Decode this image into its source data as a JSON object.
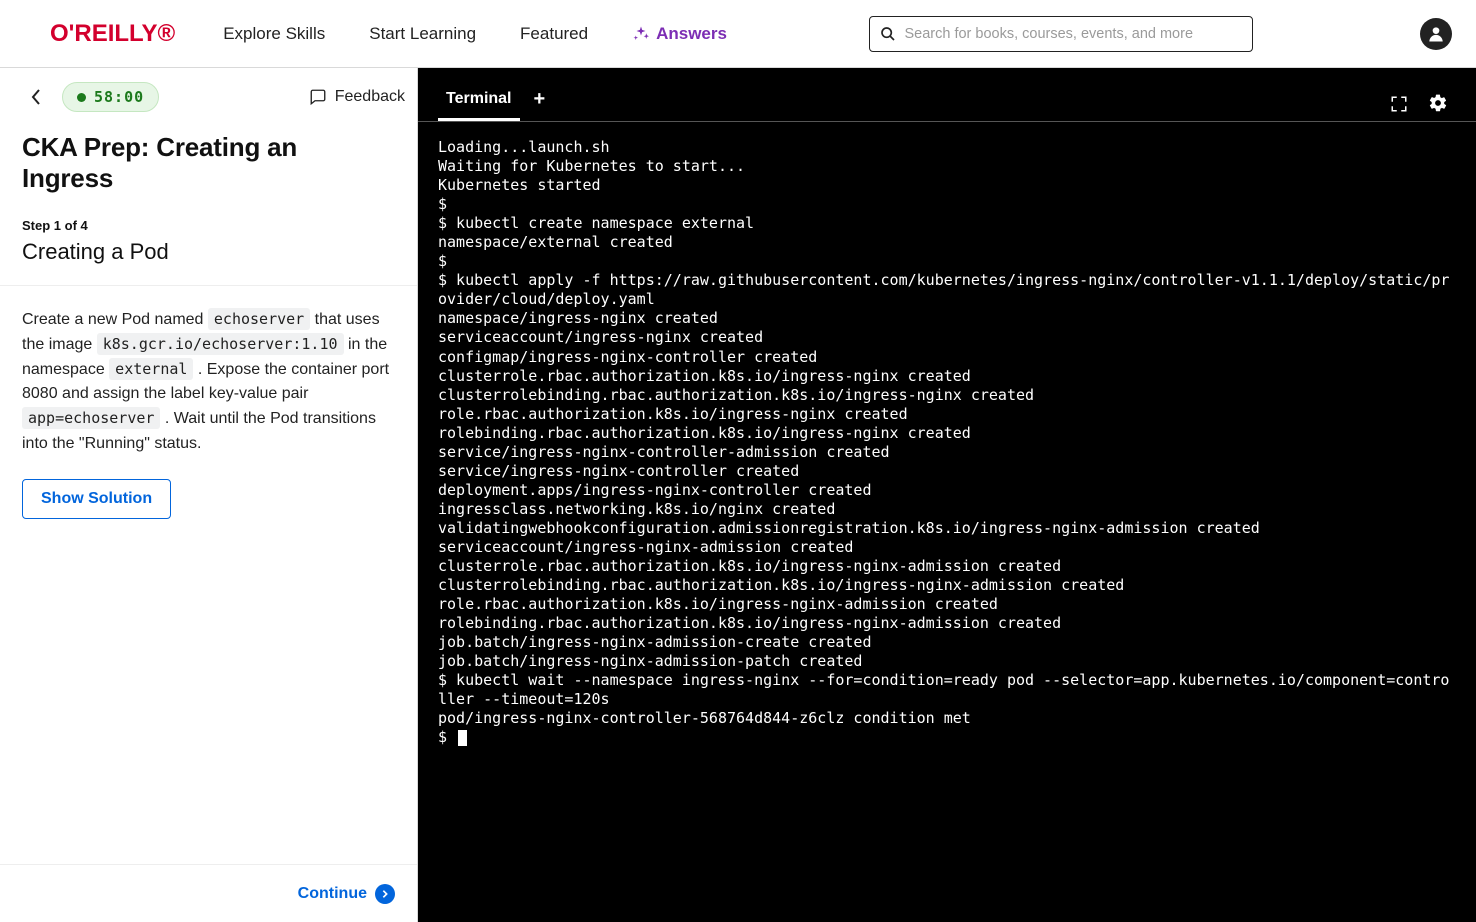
{
  "header": {
    "logo": "O'REILLY",
    "nav": {
      "explore": "Explore Skills",
      "start": "Start Learning",
      "featured": "Featured",
      "answers": "Answers"
    },
    "search_placeholder": "Search for books, courses, events, and more"
  },
  "left": {
    "timer": "58:00",
    "feedback": "Feedback",
    "title": "CKA Prep: Creating an Ingress",
    "step": "Step 1 of 4",
    "subtitle": "Creating a Pod",
    "instructions": {
      "t0": "Create a new Pod named ",
      "c0": "echoserver",
      "t1": " that uses the image ",
      "c1": "k8s.gcr.io/echoserver:1.10",
      "t2": " in the namespace ",
      "c2": "external",
      "t3": " . Expose the container port 8080 and assign the label key-value pair ",
      "c3": "app=echoserver",
      "t4": " . Wait until the Pod transitions into the \"Running\" status."
    },
    "show_solution": "Show Solution",
    "continue": "Continue"
  },
  "terminal": {
    "tab": "Terminal",
    "output": "Loading...launch.sh\nWaiting for Kubernetes to start...\nKubernetes started\n$\n$ kubectl create namespace external\nnamespace/external created\n$\n$ kubectl apply -f https://raw.githubusercontent.com/kubernetes/ingress-nginx/controller-v1.1.1/deploy/static/provider/cloud/deploy.yaml\nnamespace/ingress-nginx created\nserviceaccount/ingress-nginx created\nconfigmap/ingress-nginx-controller created\nclusterrole.rbac.authorization.k8s.io/ingress-nginx created\nclusterrolebinding.rbac.authorization.k8s.io/ingress-nginx created\nrole.rbac.authorization.k8s.io/ingress-nginx created\nrolebinding.rbac.authorization.k8s.io/ingress-nginx created\nservice/ingress-nginx-controller-admission created\nservice/ingress-nginx-controller created\ndeployment.apps/ingress-nginx-controller created\ningressclass.networking.k8s.io/nginx created\nvalidatingwebhookconfiguration.admissionregistration.k8s.io/ingress-nginx-admission created\nserviceaccount/ingress-nginx-admission created\nclusterrole.rbac.authorization.k8s.io/ingress-nginx-admission created\nclusterrolebinding.rbac.authorization.k8s.io/ingress-nginx-admission created\nrole.rbac.authorization.k8s.io/ingress-nginx-admission created\nrolebinding.rbac.authorization.k8s.io/ingress-nginx-admission created\njob.batch/ingress-nginx-admission-create created\njob.batch/ingress-nginx-admission-patch created\n$ kubectl wait --namespace ingress-nginx --for=condition=ready pod --selector=app.kubernetes.io/component=controller --timeout=120s\npod/ingress-nginx-controller-568764d844-z6clz condition met\n$ "
  }
}
